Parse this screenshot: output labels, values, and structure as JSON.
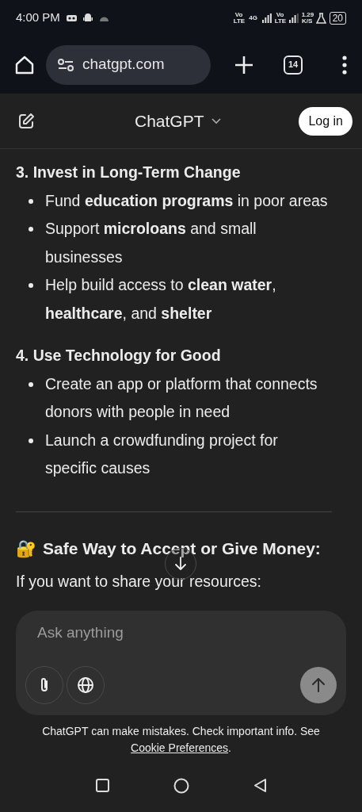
{
  "status_bar": {
    "time": "4:00 PM",
    "network_1": "Vo LTE",
    "network_type": "4G",
    "network_2": "Vo LTE",
    "speed": "1.29",
    "speed_unit": "K/S",
    "battery": "20"
  },
  "browser": {
    "url": "chatgpt.com",
    "tab_count": "14"
  },
  "header": {
    "title": "ChatGPT",
    "login": "Log in"
  },
  "sections": [
    {
      "heading": "3. Invest in Long-Term Change",
      "bullets": [
        "Fund **education programs** in poor areas",
        "Support **microloans** and small businesses",
        "Help build access to **clean water**, **healthcare**, and **shelter**"
      ]
    },
    {
      "heading": "4. Use Technology for Good",
      "bullets": [
        "Create an app or platform that connects donors with people in need",
        "Launch a crowdfunding project for specific causes"
      ]
    }
  ],
  "next_heading": {
    "emoji": "🔐",
    "text": "Safe Way to Accept or Give Money:"
  },
  "paragraph": "If you want to share your resources:",
  "composer": {
    "placeholder": "Ask anything"
  },
  "disclaimer": {
    "text": "ChatGPT can make mistakes. Check important info. See ",
    "link": "Cookie Preferences",
    "end": "."
  }
}
